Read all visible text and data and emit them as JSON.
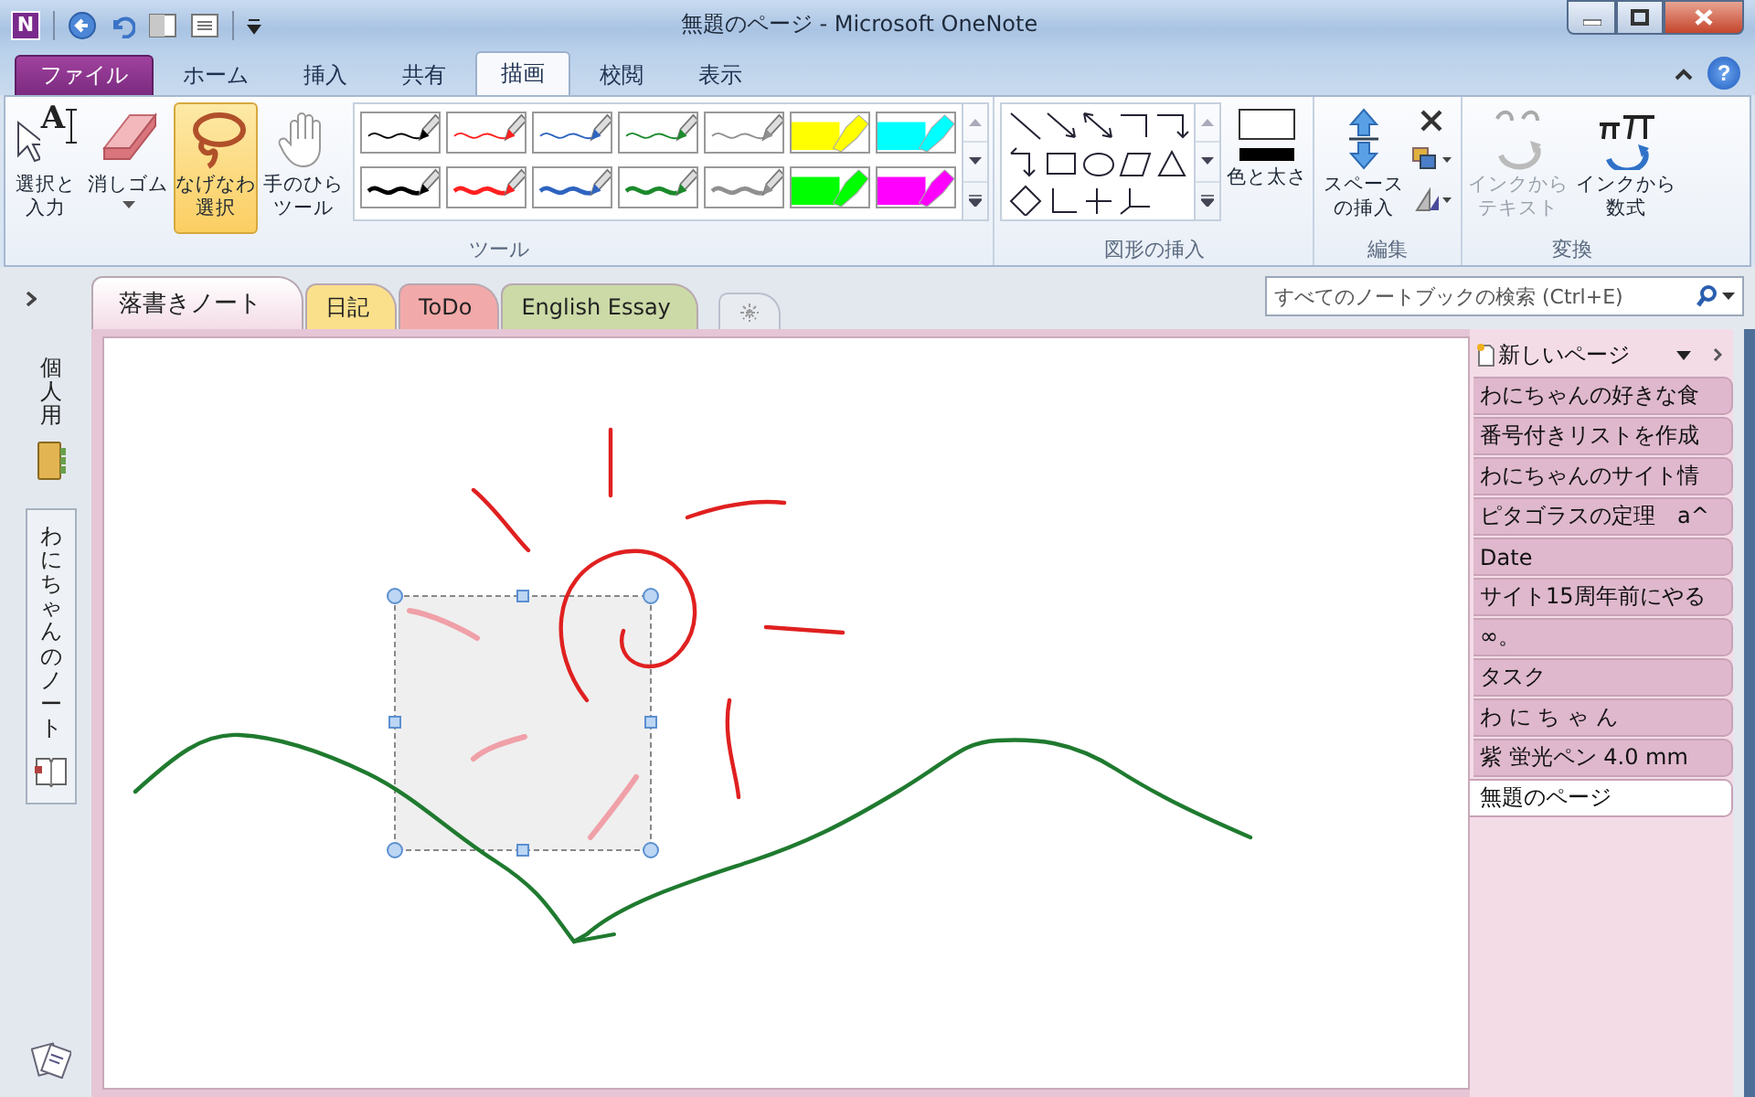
{
  "window": {
    "title": "無題のページ - Microsoft OneNote",
    "app_logo": "N",
    "help": "?"
  },
  "ribbon_tabs": [
    {
      "label": "ファイル",
      "kind": "file",
      "selected": false
    },
    {
      "label": "ホーム",
      "kind": "tab",
      "selected": false
    },
    {
      "label": "挿入",
      "kind": "tab",
      "selected": false
    },
    {
      "label": "共有",
      "kind": "tab",
      "selected": false
    },
    {
      "label": "描画",
      "kind": "tab",
      "selected": true
    },
    {
      "label": "校閲",
      "kind": "tab",
      "selected": false
    },
    {
      "label": "表示",
      "kind": "tab",
      "selected": false
    }
  ],
  "tools": [
    {
      "kind": "select",
      "lines": [
        "選択と",
        "入力"
      ],
      "glyph": "A",
      "selected": false
    },
    {
      "kind": "eraser",
      "lines": [
        "消しゴム"
      ],
      "selected": false
    },
    {
      "kind": "lasso",
      "lines": [
        "なげなわ",
        "選択"
      ],
      "selected": true
    },
    {
      "kind": "hand",
      "lines": [
        "手のひら",
        "ツール"
      ],
      "selected": false
    }
  ],
  "pens": [
    {
      "kind": "pen-thin",
      "color": "#000000"
    },
    {
      "kind": "pen-thin",
      "color": "#ff2020"
    },
    {
      "kind": "pen-thin",
      "color": "#2e64c0"
    },
    {
      "kind": "pen-thin",
      "color": "#1c8a2c"
    },
    {
      "kind": "pen-thin",
      "color": "#909090"
    },
    {
      "kind": "highlighter",
      "color": "#ffff00"
    },
    {
      "kind": "highlighter",
      "color": "#00ffff"
    },
    {
      "kind": "pen-thick",
      "color": "#000000"
    },
    {
      "kind": "pen-thick",
      "color": "#ff2020"
    },
    {
      "kind": "pen-thick",
      "color": "#2e64c0"
    },
    {
      "kind": "pen-thick",
      "color": "#1c8a2c"
    },
    {
      "kind": "pen-thick",
      "color": "#909090"
    },
    {
      "kind": "highlighter",
      "color": "#00ff00"
    },
    {
      "kind": "highlighter",
      "color": "#ff00ff"
    }
  ],
  "tools_group_label": "ツール",
  "shapes_group": {
    "label": "図形の挿入",
    "color_weight": "色と太さ"
  },
  "edit_group": {
    "label": "編集",
    "insert_space": [
      "スペース",
      "の挿入"
    ]
  },
  "convert_group": {
    "label": "変換",
    "buttons": [
      {
        "kind": "text",
        "lines": [
          "インクから",
          "テキスト"
        ],
        "disabled": true
      },
      {
        "kind": "math",
        "lines": [
          "インクから",
          "数式"
        ],
        "disabled": false
      }
    ]
  },
  "section_tabs": [
    {
      "label": "落書きノート",
      "color": "#f4dce7",
      "selected": true
    },
    {
      "label": "日記",
      "color": "#fbe08c",
      "selected": false
    },
    {
      "label": "ToDo",
      "color": "#f2a9a9",
      "selected": false
    },
    {
      "label": "English Essay",
      "color": "#cbdaa6",
      "selected": false
    }
  ],
  "search": {
    "placeholder": "すべてのノートブックの検索 (Ctrl+E)"
  },
  "notebooks": [
    {
      "label": "個人用",
      "selected": false
    },
    {
      "label": "わにちゃんのノート",
      "selected": true
    }
  ],
  "new_page": "新しいページ",
  "pages": [
    {
      "title": "わにちゃんの好きな食",
      "selected": false
    },
    {
      "title": "番号付きリストを作成",
      "selected": false
    },
    {
      "title": "わにちゃんのサイト情",
      "selected": false
    },
    {
      "title": "ピタゴラスの定理　a^",
      "selected": false
    },
    {
      "title": "Date",
      "selected": false
    },
    {
      "title": "サイト15周年前にやる",
      "selected": false
    },
    {
      "title": "∞。",
      "selected": false
    },
    {
      "title": "タスク",
      "selected": false
    },
    {
      "title": "わ に ち ゃ ん",
      "selected": false
    },
    {
      "title": "紫 蛍光ペン 4.0 mm",
      "selected": false
    },
    {
      "title": "無題のページ",
      "selected": true
    }
  ]
}
